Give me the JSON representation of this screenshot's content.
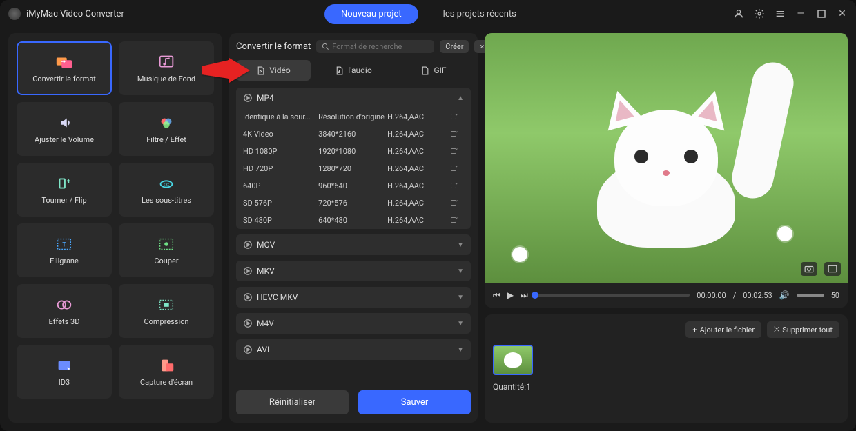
{
  "app": {
    "title": "iMyMac Video Converter"
  },
  "titlebar": {
    "new_project": "Nouveau projet",
    "recent_projects": "les projets récents"
  },
  "sidebar": {
    "tools": [
      {
        "label": "Convertir le format",
        "icon": "convert",
        "active": true
      },
      {
        "label": "Musique de Fond",
        "icon": "music",
        "active": false
      },
      {
        "label": "Ajuster le Volume",
        "icon": "volume",
        "active": false
      },
      {
        "label": "Filtre / Effet",
        "icon": "filter",
        "active": false
      },
      {
        "label": "Tourner / Flip",
        "icon": "rotate",
        "active": false
      },
      {
        "label": "Les sous-titres",
        "icon": "subtitle",
        "active": false
      },
      {
        "label": "Filigrane",
        "icon": "watermark",
        "active": false
      },
      {
        "label": "Couper",
        "icon": "trim",
        "active": false
      },
      {
        "label": "Effets 3D",
        "icon": "3d",
        "active": false
      },
      {
        "label": "Compression",
        "icon": "compress",
        "active": false
      },
      {
        "label": "ID3",
        "icon": "id3",
        "active": false
      },
      {
        "label": "Capture d'écran",
        "icon": "screenshot",
        "active": false
      }
    ]
  },
  "panel": {
    "title": "Convertir le format",
    "search_placeholder": "Format de recherche",
    "create": "Créer",
    "close": "×",
    "tabs": {
      "video": "Vidéo",
      "audio": "l'audio",
      "gif": "GIF"
    },
    "groups": [
      {
        "name": "MP4",
        "expanded": true,
        "rows": [
          {
            "name": "Identique à la sour...",
            "res": "Résolution d'origine",
            "codec": "H.264,AAC"
          },
          {
            "name": "4K Video",
            "res": "3840*2160",
            "codec": "H.264,AAC"
          },
          {
            "name": "HD 1080P",
            "res": "1920*1080",
            "codec": "H.264,AAC"
          },
          {
            "name": "HD 720P",
            "res": "1280*720",
            "codec": "H.264,AAC"
          },
          {
            "name": "640P",
            "res": "960*640",
            "codec": "H.264,AAC"
          },
          {
            "name": "SD 576P",
            "res": "720*576",
            "codec": "H.264,AAC"
          },
          {
            "name": "SD 480P",
            "res": "640*480",
            "codec": "H.264,AAC"
          }
        ]
      },
      {
        "name": "MOV",
        "expanded": false
      },
      {
        "name": "MKV",
        "expanded": false
      },
      {
        "name": "HEVC MKV",
        "expanded": false
      },
      {
        "name": "M4V",
        "expanded": false
      },
      {
        "name": "AVI",
        "expanded": false
      }
    ],
    "reset": "Réinitialiser",
    "save": "Sauver"
  },
  "player": {
    "time_current": "00:00:00",
    "time_total": "00:02:53",
    "volume": "50"
  },
  "queue": {
    "add": "Ajouter le fichier",
    "delete_all": "Supprimer tout",
    "quantity_label": "Quantité:",
    "quantity_value": "1"
  }
}
